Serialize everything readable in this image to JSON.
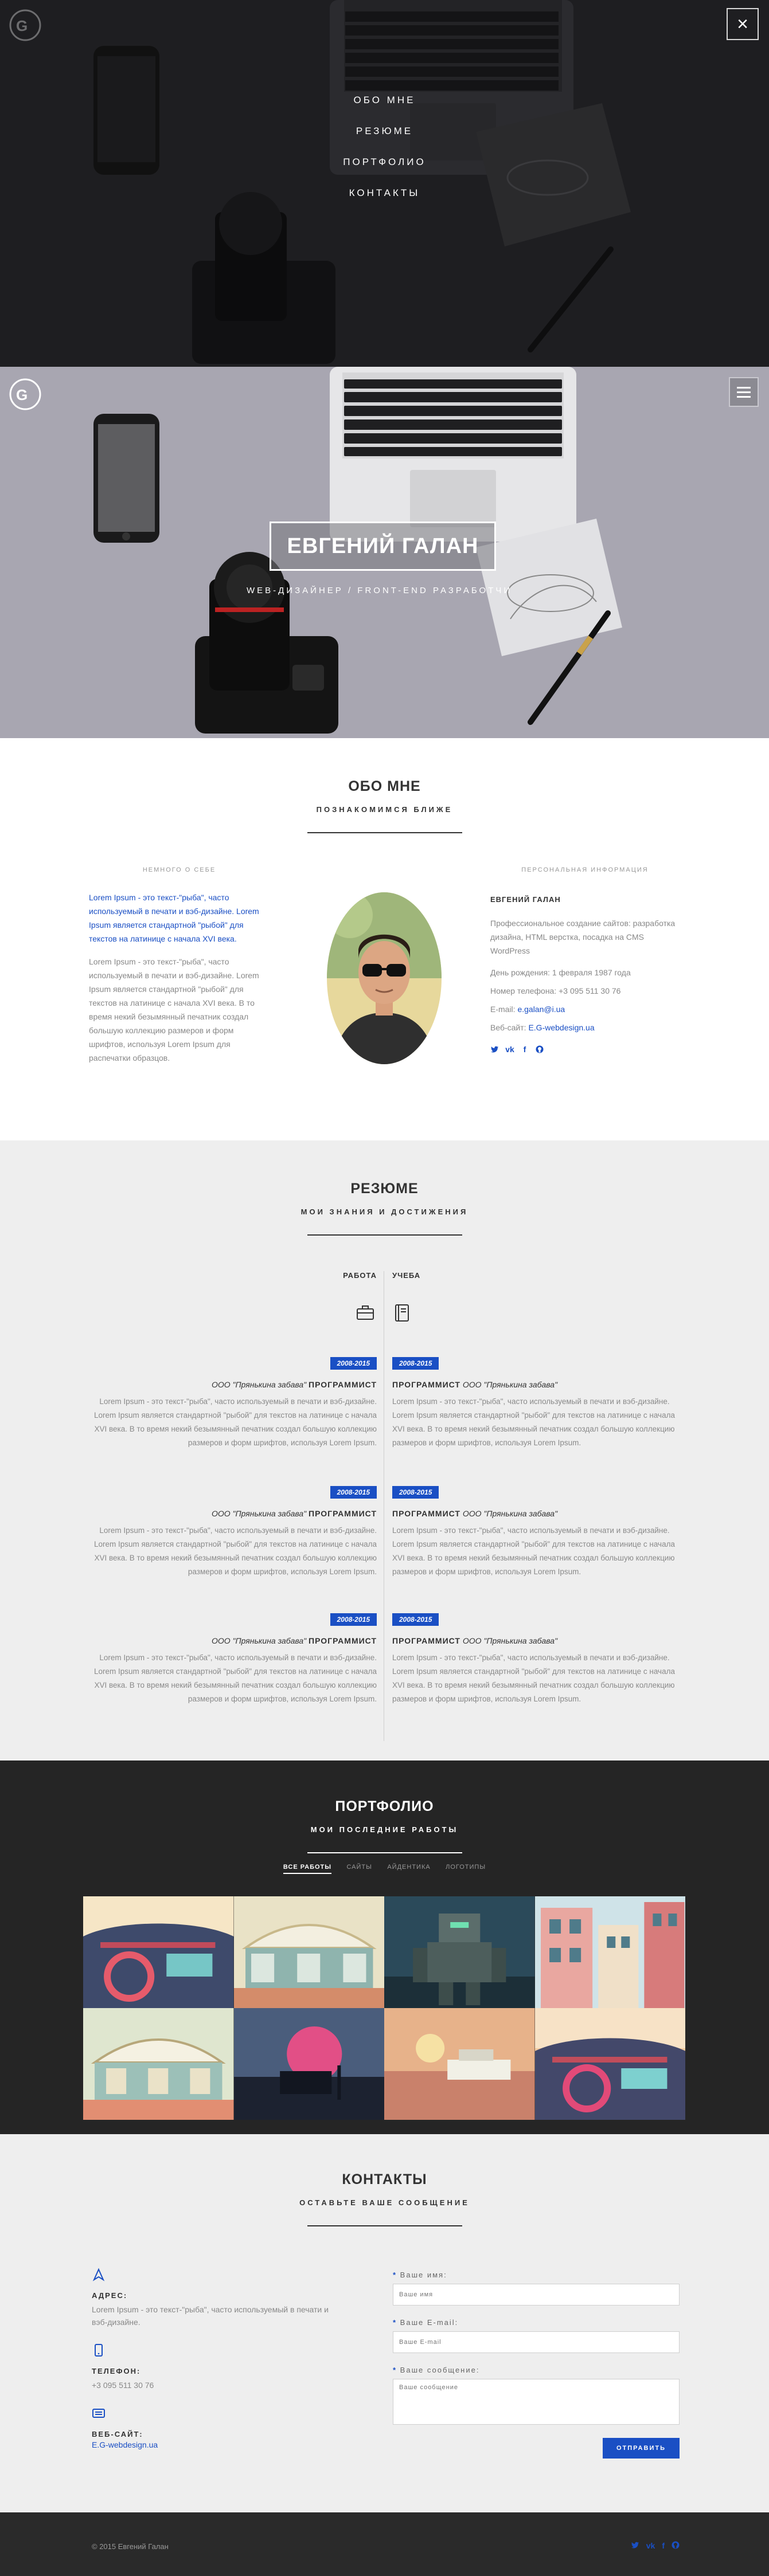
{
  "overlay": {
    "menu": [
      "ОБО МНЕ",
      "РЕЗЮМЕ",
      "ПОРТФОЛИО",
      "КОНТАКТЫ"
    ],
    "close": "×"
  },
  "hero": {
    "title": "ЕВГЕНИЙ ГАЛАН",
    "subtitle": "WEB-ДИЗАЙНЕР / FRONT-END РАЗРАБОТЧИК"
  },
  "about": {
    "title": "ОБО МНЕ",
    "subtitle": "ПОЗНАКОМИМСЯ БЛИЖЕ",
    "left_label": "НЕМНОГО О СЕБЕ",
    "lead": "Lorem Ipsum - это текст-\"рыба\", часто используемый в печати и вэб-дизайне. Lorem Ipsum является стандартной \"рыбой\" для текстов на латинице с начала XVI века.",
    "body": "Lorem Ipsum - это текст-\"рыба\", часто используемый в печати и вэб-дизайне. Lorem Ipsum является стандартной \"рыбой\" для текстов на латинице с начала XVI века. В то время некий безымянный печатник создал большую коллекцию размеров и форм шрифтов, используя Lorem Ipsum для распечатки образцов.",
    "right_label": "ПЕРСОНАЛЬНАЯ ИНФОРМАЦИЯ",
    "name": "ЕВГЕНИЙ ГАЛАН",
    "profession": "Профессиональное создание сайтов: разработка дизайна, HTML верстка, посадка на CMS WordPress",
    "birthday": "День рождения: 1 февраля 1987 года",
    "phone": "Номер телефона: +3 095 511 30 76",
    "email_label": "E-mail: ",
    "email": "e.galan@i.ua",
    "site_label": "Веб-сайт: ",
    "site": "E.G-webdesign.ua",
    "socials": [
      "twitter-icon",
      "vk-icon",
      "facebook-icon",
      "github-icon"
    ]
  },
  "resume": {
    "title": "РЕЗЮМЕ",
    "subtitle": "МОИ ЗНАНИЯ И ДОСТИЖЕНИЯ",
    "work_label": "РАБОТА",
    "study_label": "УЧЕБА",
    "entries": [
      {
        "left": {
          "period": "2008-2015",
          "company": "ООО \"Прянькина забава\"",
          "role": "ПРОГРАММИСТ",
          "desc": "Lorem Ipsum - это текст-\"рыба\", часто используемый в печати и вэб-дизайне. Lorem Ipsum является стандартной \"рыбой\" для текстов на латинице с начала XVI века. В то время некий безымянный печатник создал большую коллекцию размеров и форм шрифтов, используя Lorem Ipsum."
        },
        "right": {
          "period": "2008-2015",
          "company": "ООО \"Прянькина забава\"",
          "role": "ПРОГРАММИСТ",
          "desc": "Lorem Ipsum - это текст-\"рыба\", часто используемый в печати и вэб-дизайне. Lorem Ipsum является стандартной \"рыбой\" для текстов на латинице с начала XVI века. В то время некий безымянный печатник создал большую коллекцию размеров и форм шрифтов, используя Lorem Ipsum."
        }
      },
      {
        "left": {
          "period": "2008-2015",
          "company": "ООО \"Прянькина забава\"",
          "role": "ПРОГРАММИСТ",
          "desc": "Lorem Ipsum - это текст-\"рыба\", часто используемый в печати и вэб-дизайне. Lorem Ipsum является стандартной \"рыбой\" для текстов на латинице с начала XVI века. В то время некий безымянный печатник создал большую коллекцию размеров и форм шрифтов, используя Lorem Ipsum."
        },
        "right": {
          "period": "2008-2015",
          "company": "ООО \"Прянькина забава\"",
          "role": "ПРОГРАММИСТ",
          "desc": "Lorem Ipsum - это текст-\"рыба\", часто используемый в печати и вэб-дизайне. Lorem Ipsum является стандартной \"рыбой\" для текстов на латинице с начала XVI века. В то время некий безымянный печатник создал большую коллекцию размеров и форм шрифтов, используя Lorem Ipsum."
        }
      },
      {
        "left": {
          "period": "2008-2015",
          "company": "ООО \"Прянькина забава\"",
          "role": "ПРОГРАММИСТ",
          "desc": "Lorem Ipsum - это текст-\"рыба\", часто используемый в печати и вэб-дизайне. Lorem Ipsum является стандартной \"рыбой\" для текстов на латинице с начала XVI века. В то время некий безымянный печатник создал большую коллекцию размеров и форм шрифтов, используя Lorem Ipsum."
        },
        "right": {
          "period": "2008-2015",
          "company": "ООО \"Прянькина забава\"",
          "role": "ПРОГРАММИСТ",
          "desc": "Lorem Ipsum - это текст-\"рыба\", часто используемый в печати и вэб-дизайне. Lorem Ipsum является стандартной \"рыбой\" для текстов на латинице с начала XVI века. В то время некий безымянный печатник создал большую коллекцию размеров и форм шрифтов, используя Lorem Ipsum."
        }
      }
    ]
  },
  "portfolio": {
    "title": "ПОРТФОЛИО",
    "subtitle": "МОИ ПОСЛЕДНИЕ РАБОТЫ",
    "filters": [
      "ВСЕ РАБОТЫ",
      "САЙТЫ",
      "АЙДЕНТИКА",
      "ЛОГОТИПЫ"
    ]
  },
  "contacts": {
    "title": "КОНТАКТЫ",
    "subtitle": "ОСТАВЬТЕ ВАШЕ СООБЩЕНИЕ",
    "address_label": "АДРЕС:",
    "address": "Lorem Ipsum - это текст-\"рыба\", часто используемый в печати и вэб-дизайне.",
    "phone_label": "ТЕЛЕФОН:",
    "phone": "+3 095 511 30 76",
    "site_label": "ВЕБ-САЙТ:",
    "site": "E.G-webdesign.ua",
    "form": {
      "name_label": "Ваше имя:",
      "name_ph": "Ваше имя",
      "email_label": "Ваше E-mail:",
      "email_ph": "Ваше E-mail",
      "msg_label": "Ваше сообщение:",
      "msg_ph": "Ваше сообщение",
      "submit": "ОТПРАВИТЬ"
    }
  },
  "footer": {
    "copyright": "© 2015 Евгений Галан"
  },
  "colors": {
    "accent": "#1a4fc4",
    "dark": "#252525",
    "light": "#eeeeee"
  }
}
